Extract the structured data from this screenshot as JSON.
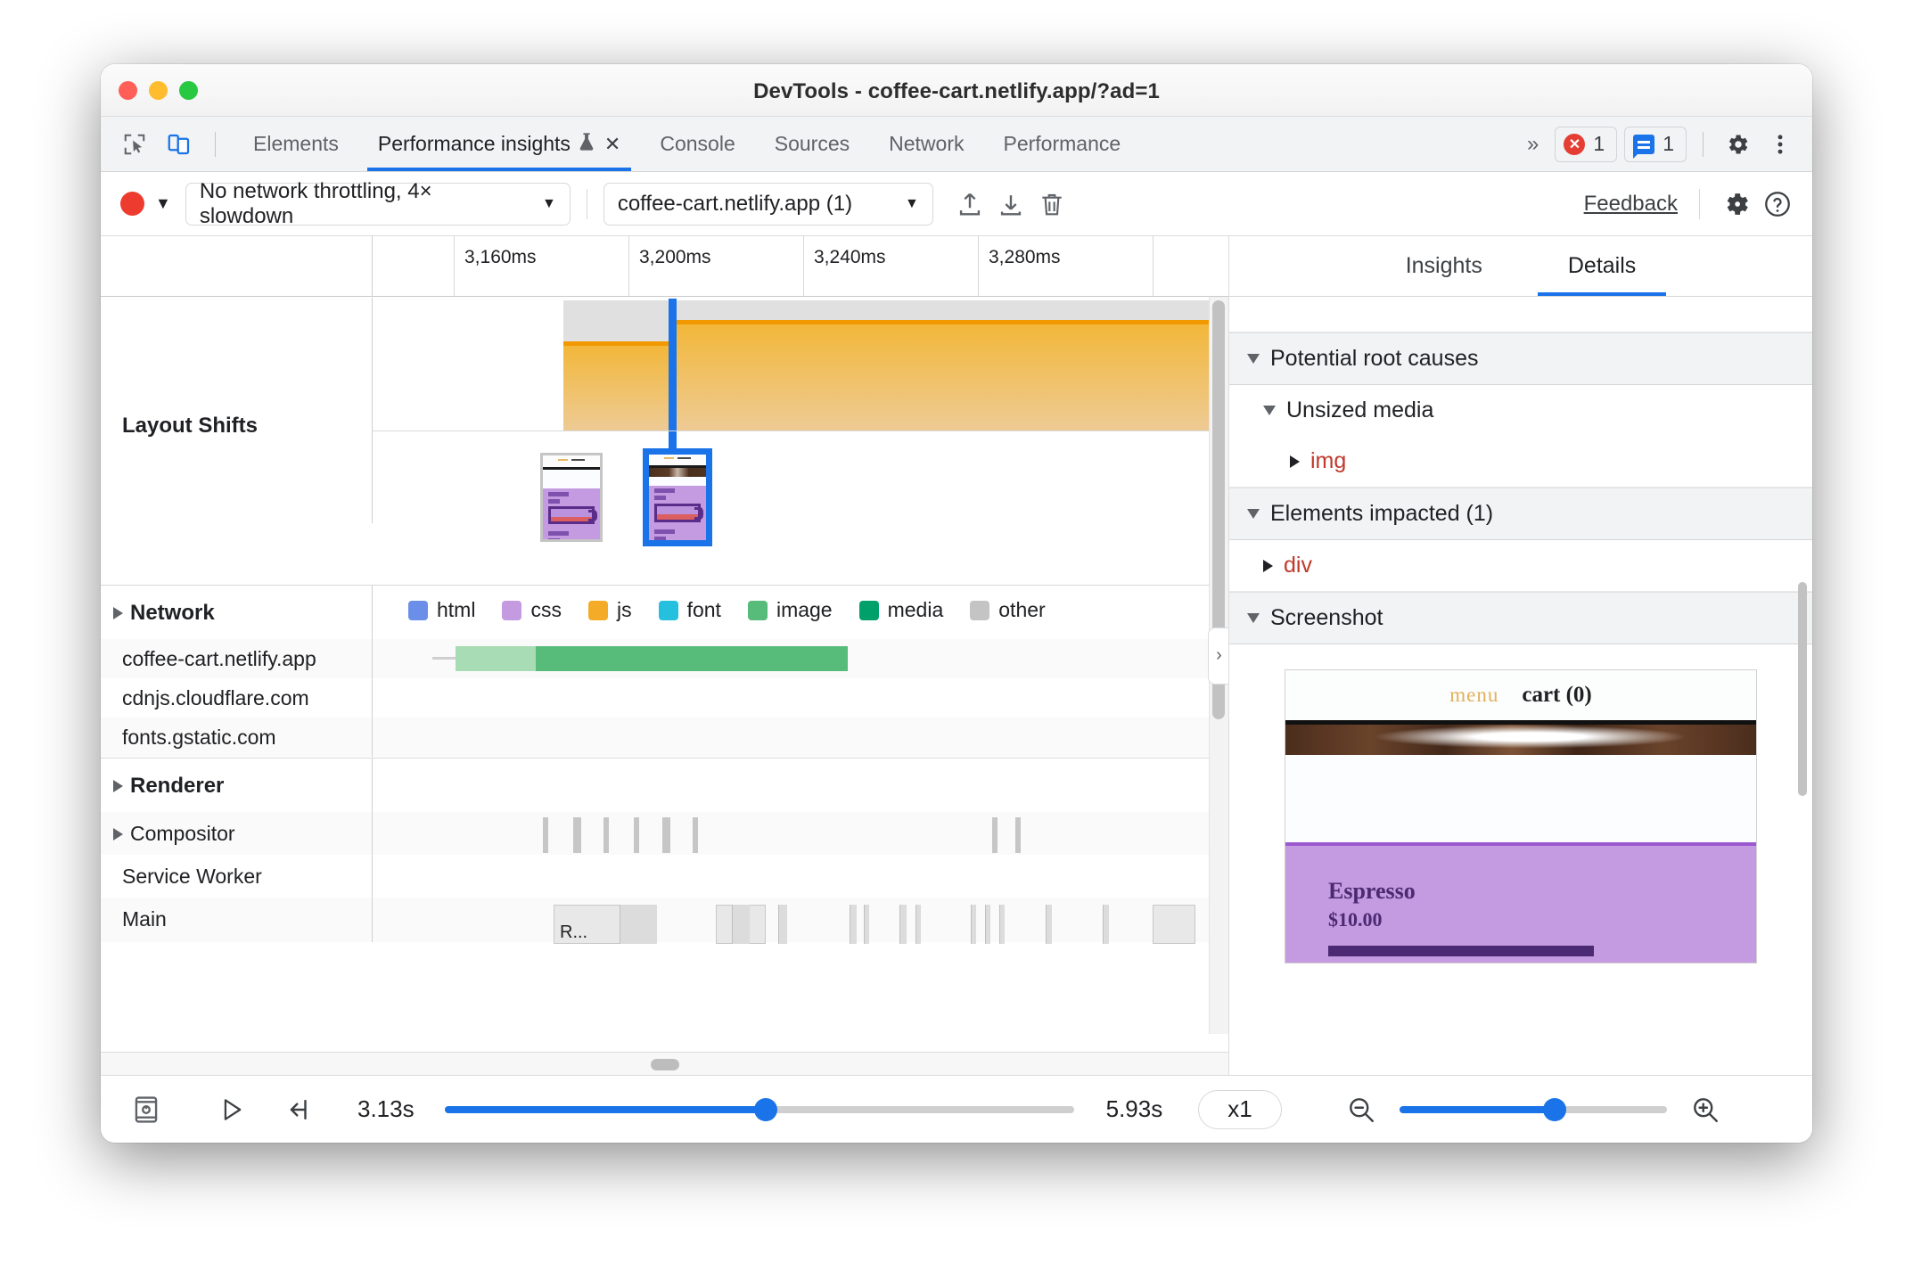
{
  "window": {
    "title": "DevTools - coffee-cart.netlify.app/?ad=1"
  },
  "tabbar": {
    "inspect_icon": "inspect-cursor-icon",
    "device_icon": "device-toolbar-icon",
    "tabs": [
      {
        "label": "Elements",
        "active": false
      },
      {
        "label": "Performance insights",
        "active": true,
        "experimental": true,
        "closable": true
      },
      {
        "label": "Console",
        "active": false
      },
      {
        "label": "Sources",
        "active": false
      },
      {
        "label": "Network",
        "active": false
      },
      {
        "label": "Performance",
        "active": false
      }
    ],
    "overflow": "»",
    "error_count": "1",
    "message_count": "1",
    "settings_icon": "gear-icon",
    "more_icon": "more-vertical-icon",
    "close_glyph": "✕",
    "flask_glyph": "⚗"
  },
  "toolbar": {
    "record_label": "record-button",
    "caret_glyph": "▼",
    "throttling": "No network throttling, 4× slowdown",
    "trace_select": "coffee-cart.netlify.app (1)",
    "upload_icon": "upload-icon",
    "download_icon": "download-icon",
    "trash_icon": "trash-icon",
    "feedback": "Feedback",
    "settings_icon": "gear-icon",
    "help_icon": "help-icon"
  },
  "timeline": {
    "ruler_ticks": [
      "3,160ms",
      "3,200ms",
      "3,240ms",
      "3,280ms"
    ],
    "tracks": [
      {
        "name": "Layout Shifts",
        "type": "group",
        "expanded": true
      },
      {
        "name": "Network",
        "type": "group",
        "expanded": false
      },
      {
        "name": "coffee-cart.netlify.app",
        "type": "row"
      },
      {
        "name": "cdnjs.cloudflare.com",
        "type": "row"
      },
      {
        "name": "fonts.gstatic.com",
        "type": "row"
      },
      {
        "name": "Renderer",
        "type": "group",
        "expanded": false
      },
      {
        "name": "Compositor",
        "type": "subgroup",
        "expanded": false
      },
      {
        "name": "Service Worker",
        "type": "row"
      },
      {
        "name": "Main",
        "type": "row"
      }
    ],
    "legend": [
      {
        "label": "html",
        "color": "#6b8ee8"
      },
      {
        "label": "css",
        "color": "#c49ae0"
      },
      {
        "label": "js",
        "color": "#f4ab28"
      },
      {
        "label": "font",
        "color": "#25c0dd"
      },
      {
        "label": "media",
        "color": "#00a06b"
      },
      {
        "label": "image",
        "color": "#57bb79"
      },
      {
        "label": "other",
        "color": "#c4c4c4"
      }
    ],
    "legend_order": [
      "html",
      "css",
      "js",
      "font",
      "image",
      "media",
      "other"
    ],
    "main_event_label": "R...",
    "thumbnails": [
      {
        "selected": false,
        "name": "layout-shift-thumbnail-1"
      },
      {
        "selected": true,
        "name": "layout-shift-thumbnail-2"
      }
    ]
  },
  "sidebar": {
    "tabs": [
      {
        "label": "Insights",
        "active": false
      },
      {
        "label": "Details",
        "active": true
      }
    ],
    "sections": [
      {
        "title": "Potential root causes",
        "expanded": true
      },
      {
        "title": "Elements impacted (1)",
        "expanded": true
      },
      {
        "title": "Screenshot",
        "expanded": true
      }
    ],
    "root_cause_group": "Unsized media",
    "root_cause_node": "img",
    "impacted_node": "div",
    "collapse_handle": "›"
  },
  "screenshot_preview": {
    "menu": "menu",
    "cart": "cart (0)",
    "product_title": "Espresso",
    "product_price": "$10.00"
  },
  "bottombar": {
    "filmstrip_icon": "filmstrip-icon",
    "play_icon": "play-icon",
    "jump_start_icon": "jump-to-start-icon",
    "start_time": "3.13s",
    "end_time": "5.93s",
    "speed": "x1",
    "zoom_out_icon": "zoom-out-icon",
    "zoom_in_icon": "zoom-in-icon",
    "time_progress_pct": 51,
    "zoom_level_pct": 58
  },
  "colors": {
    "accent": "#1a73e8",
    "record": "#ee3b2f",
    "layout_shift": "#f29900",
    "tag_red": "#c0392b"
  }
}
